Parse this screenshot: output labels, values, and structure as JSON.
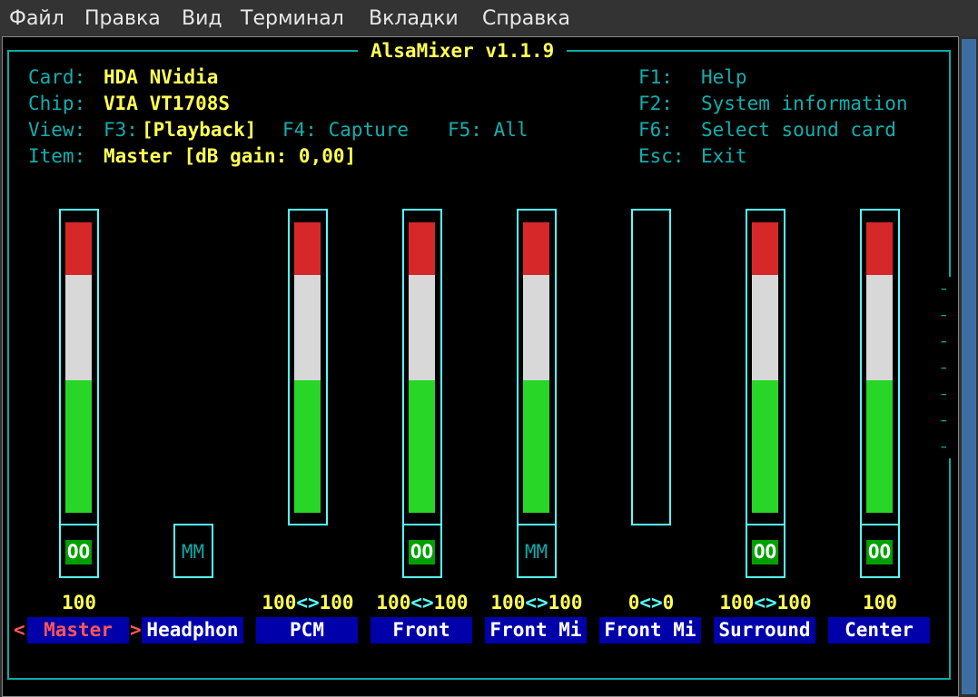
{
  "menubar": {
    "items": [
      "Файл",
      "Правка",
      "Вид",
      "Терминал",
      "Вкладки",
      "Справка"
    ]
  },
  "mixer": {
    "title": "AlsaMixer v1.1.9",
    "card_label": "Card:",
    "card": "HDA NVidia",
    "chip_label": "Chip:",
    "chip": "VIA VT1708S",
    "view_label": "View:",
    "view_f3": "F3:",
    "view_playback": "[Playback]",
    "view_f4": "F4: Capture",
    "view_f5": "F5: All",
    "item_label": "Item:",
    "item": "Master [dB gain: 0,00]",
    "keys": [
      {
        "key": "F1:",
        "action": "Help"
      },
      {
        "key": "F2:",
        "action": "System information"
      },
      {
        "key": "F6:",
        "action": "Select sound card"
      },
      {
        "key": "Esc:",
        "action": "Exit"
      }
    ],
    "selected_left": "<",
    "selected_right": ">",
    "controls": [
      {
        "name": "Master",
        "value": "100",
        "volume": 100,
        "has_bar": true,
        "switch": "OO",
        "selected": true
      },
      {
        "name": "Headphon",
        "value": "",
        "volume": null,
        "has_bar": false,
        "switch": "MM"
      },
      {
        "name": "PCM",
        "value": "100<>100",
        "volume": 100,
        "has_bar": true,
        "switch": null
      },
      {
        "name": "Front",
        "value": "100<>100",
        "volume": 100,
        "has_bar": true,
        "switch": "OO"
      },
      {
        "name": "Front Mi",
        "value": "100<>100",
        "volume": 100,
        "has_bar": true,
        "switch": "MM"
      },
      {
        "name": "Front Mi",
        "value": "0<>0",
        "volume": 0,
        "has_bar": true,
        "switch": null
      },
      {
        "name": "Surround",
        "value": "100<>100",
        "volume": 100,
        "has_bar": true,
        "switch": "OO"
      },
      {
        "name": "Center",
        "value": "100",
        "volume": 100,
        "has_bar": true,
        "switch": "OO"
      }
    ],
    "more_arrow": "→",
    "colors": {
      "red": "#d62828",
      "white": "#d8d8d8",
      "green": "#28d628",
      "on": "#00a000",
      "border": "#55ffff",
      "label_bg": "#0000aa"
    }
  }
}
